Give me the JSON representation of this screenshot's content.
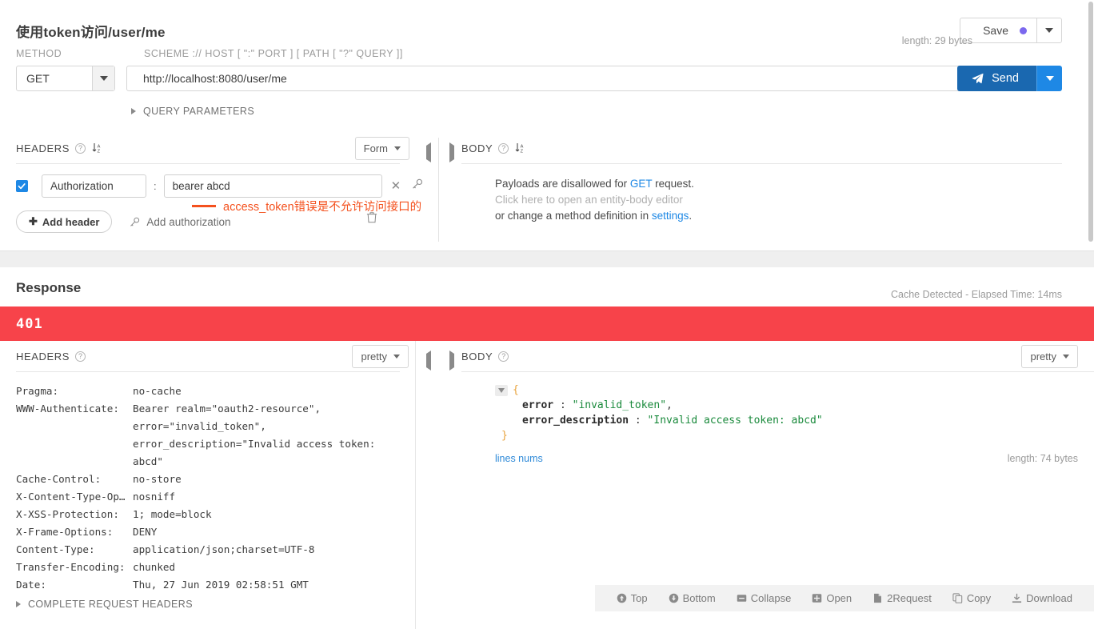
{
  "request": {
    "title": "使用token访问/user/me",
    "save": {
      "label": "Save",
      "dot_color": "#7b68ee"
    },
    "method": {
      "label": "METHOD",
      "value": "GET"
    },
    "url": {
      "label": "SCHEME :// HOST [ \":\" PORT ] [ PATH [ \"?\" QUERY ]]",
      "value": "http://localhost:8080/user/me"
    },
    "send": {
      "label": "Send"
    },
    "length": "length: 29 bytes",
    "query_parameters": {
      "label": "QUERY PARAMETERS"
    },
    "headers": {
      "title": "HEADERS",
      "view_mode": "Form",
      "rows": [
        {
          "name": "Authorization",
          "separator": ":",
          "value": "bearer abcd",
          "checked": true
        }
      ],
      "add_header": "Add header",
      "add_authorization": "Add authorization"
    },
    "annotation": "access_token错误是不允许访问接口的",
    "body": {
      "title": "BODY",
      "line1_pre": "Payloads are disallowed for ",
      "line1_link": "GET",
      "line1_post": " request.",
      "line2": "Click here to open an entity-body editor",
      "line3_pre": "or change a method definition in ",
      "line3_link": "settings",
      "line3_post": "."
    }
  },
  "response": {
    "title": "Response",
    "cache_info": "Cache Detected - Elapsed Time: 14ms",
    "status_code": "401",
    "status_color": "#f7434a",
    "headers": {
      "title": "HEADERS",
      "view_mode": "pretty",
      "rows": [
        {
          "key": "Pragma:",
          "value": "no-cache"
        },
        {
          "key": "WWW-Authenticate:",
          "value": "Bearer realm=\"oauth2-resource\", error=\"invalid_token\", error_description=\"Invalid access token: abcd\""
        },
        {
          "key": "Cache-Control:",
          "value": "no-store"
        },
        {
          "key": "X-Content-Type-Op…",
          "value": "nosniff"
        },
        {
          "key": "X-XSS-Protection:",
          "value": "1; mode=block"
        },
        {
          "key": "X-Frame-Options:",
          "value": "DENY"
        },
        {
          "key": "Content-Type:",
          "value": "application/json;charset=UTF-8"
        },
        {
          "key": "Transfer-Encoding:",
          "value": "chunked"
        },
        {
          "key": "Date:",
          "value": "Thu, 27 Jun 2019 02:58:51 GMT"
        }
      ],
      "complete_request_headers": "COMPLETE REQUEST HEADERS"
    },
    "body": {
      "title": "BODY",
      "view_mode": "pretty",
      "open_brace": "{",
      "close_brace": "}",
      "entries": [
        {
          "key": "error",
          "colon": ":",
          "value": "\"invalid_token\"",
          "comma": ","
        },
        {
          "key": "error_description",
          "colon": ":",
          "value": "\"Invalid access token: abcd\"",
          "comma": ""
        }
      ],
      "lines_nums": "lines nums",
      "length": "length: 74 bytes"
    },
    "toolbar": [
      {
        "icon": "arrow-up-circle-icon",
        "label": "Top"
      },
      {
        "icon": "arrow-down-circle-icon",
        "label": "Bottom"
      },
      {
        "icon": "minus-square-icon",
        "label": "Collapse"
      },
      {
        "icon": "plus-square-icon",
        "label": "Open"
      },
      {
        "icon": "file-icon",
        "label": "2Request"
      },
      {
        "icon": "copy-icon",
        "label": "Copy"
      },
      {
        "icon": "download-icon",
        "label": "Download"
      }
    ]
  }
}
